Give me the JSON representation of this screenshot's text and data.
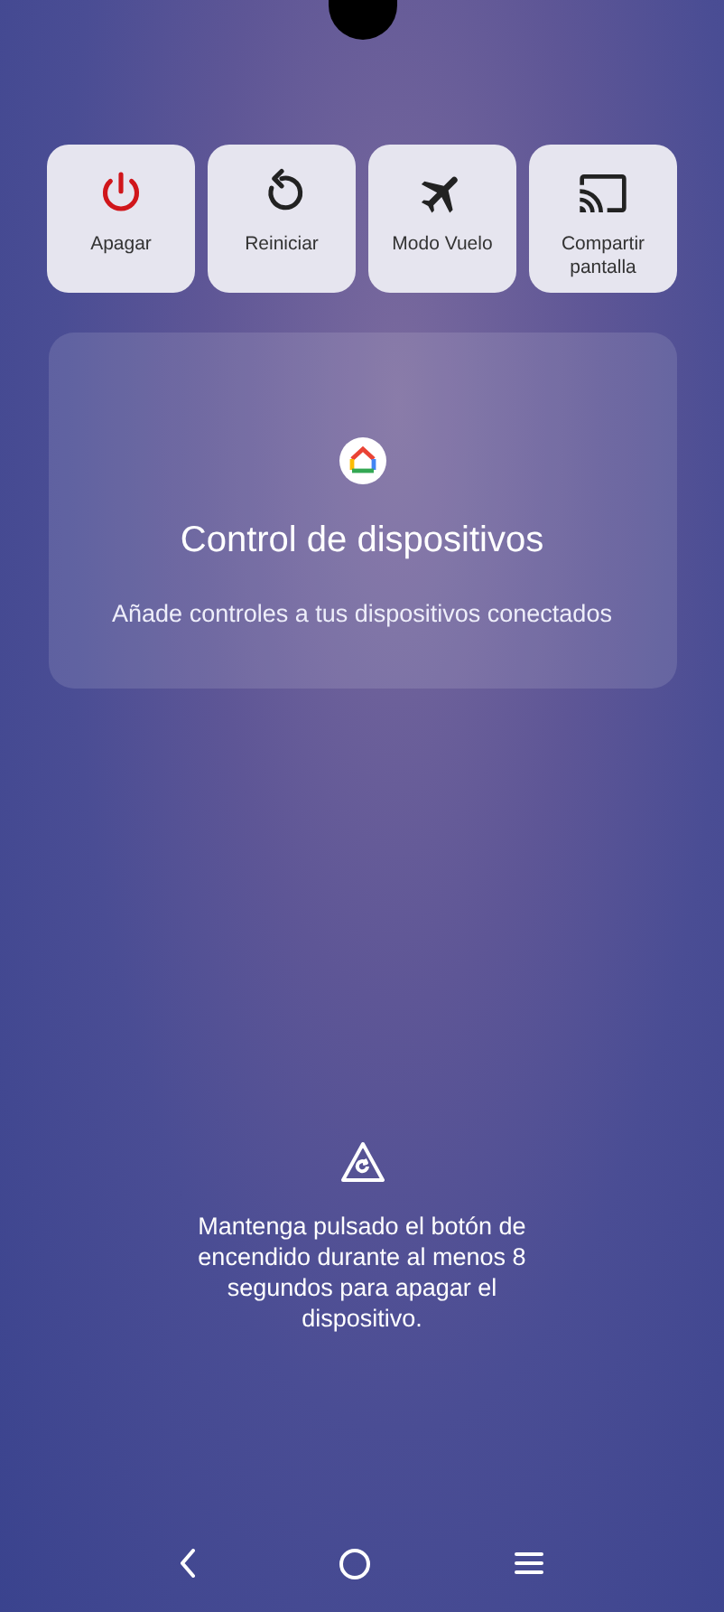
{
  "actions": [
    {
      "kind": "power",
      "label": "Apagar"
    },
    {
      "kind": "restart",
      "label": "Reiniciar"
    },
    {
      "kind": "airplane",
      "label": "Modo Vuelo"
    },
    {
      "kind": "cast",
      "label": "Compartir pantalla"
    }
  ],
  "device_controls": {
    "title": "Control de dispositivos",
    "subtitle": "Añade controles a tus dispositivos conectados"
  },
  "hint": {
    "text": "Mantenga pulsado el botón de encendido durante al menos 8 segundos para apagar el dispositivo."
  },
  "nav_bar": [
    {
      "kind": "back"
    },
    {
      "kind": "home"
    },
    {
      "kind": "recents"
    }
  ]
}
